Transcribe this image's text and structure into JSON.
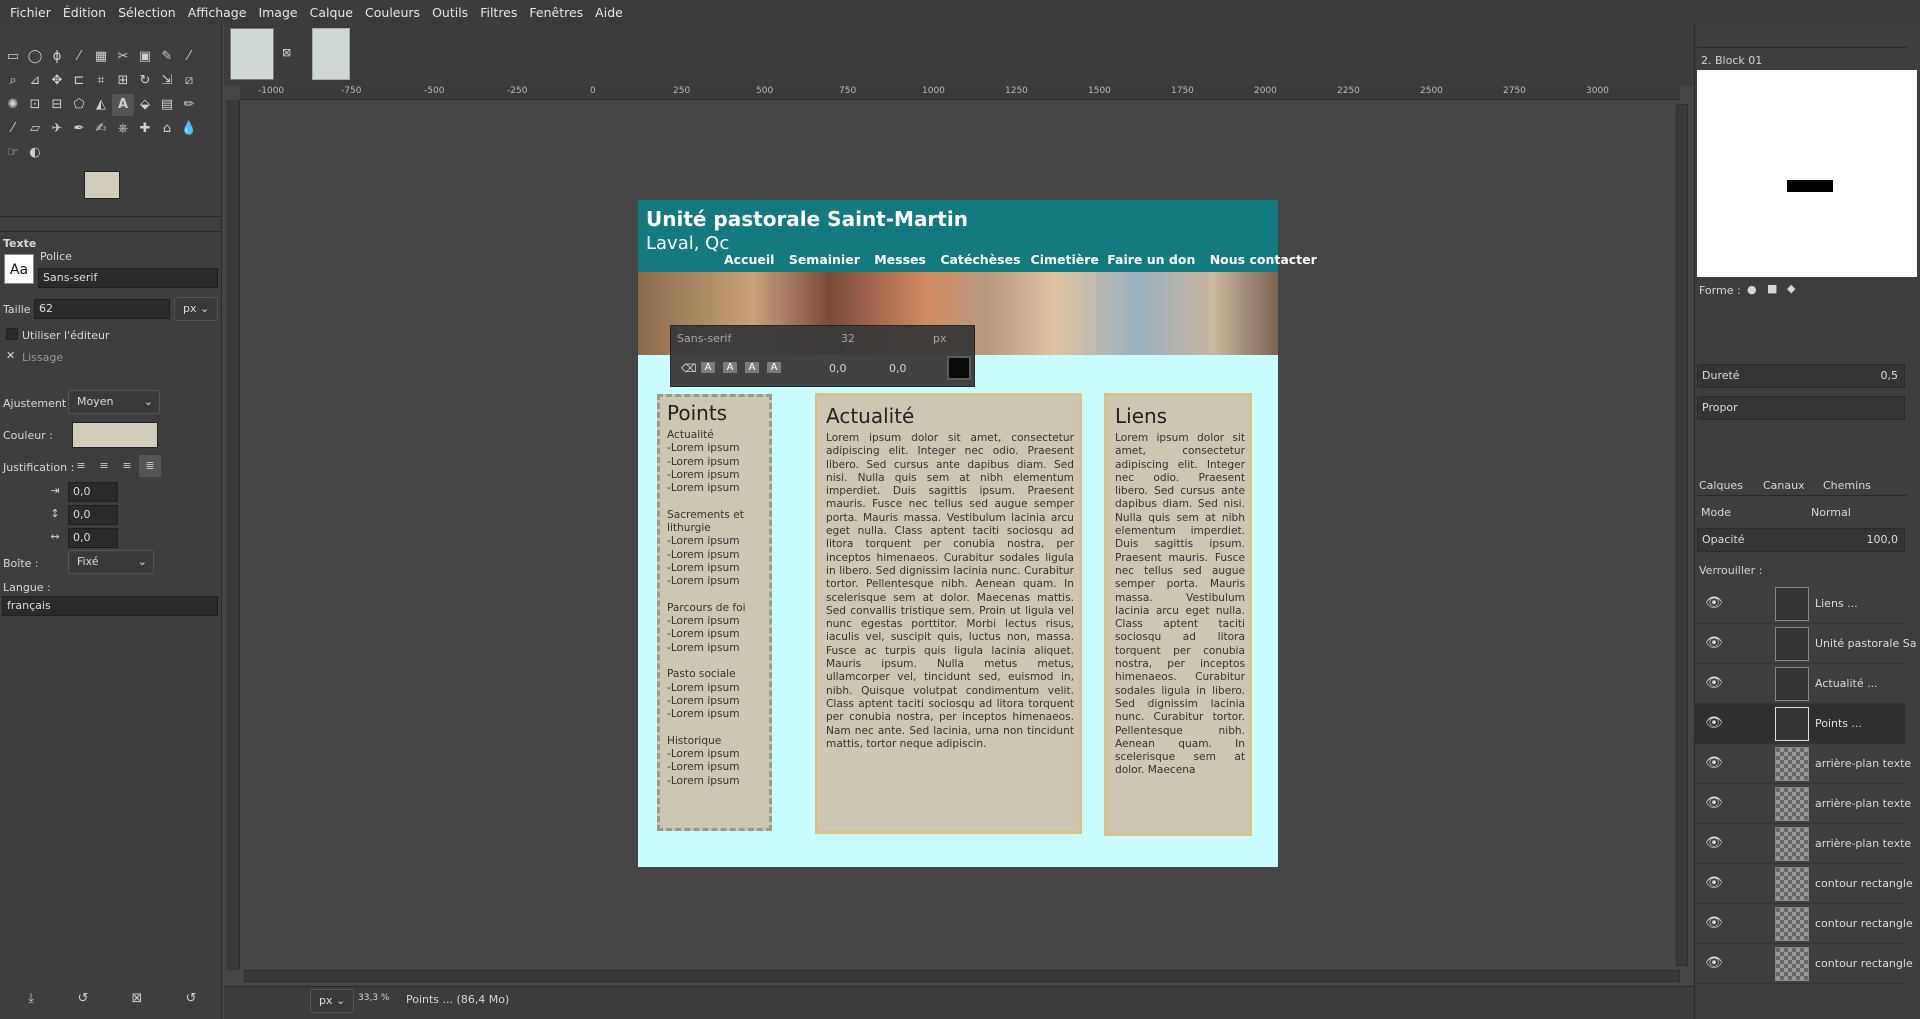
{
  "menu": [
    "Fichier",
    "Édition",
    "Sélection",
    "Affichage",
    "Image",
    "Calque",
    "Couleurs",
    "Outils",
    "Filtres",
    "Fenêtres",
    "Aide"
  ],
  "ruler": [
    "-1000",
    "-750",
    "-500",
    "-250",
    "0",
    "250",
    "500",
    "750",
    "1000",
    "1250",
    "1500",
    "1750",
    "2000",
    "2250",
    "2500",
    "2750",
    "3000"
  ],
  "tool_options": {
    "title": "Texte",
    "font_label": "Police",
    "font_value": "Sans-serif",
    "size_label": "Taille :",
    "size_value": "62",
    "size_unit": "px",
    "use_editor": "Utiliser l'éditeur",
    "antialias": "Lissage",
    "hinting_label": "Ajustement :",
    "hinting_value": "Moyen",
    "color_label": "Couleur :",
    "justify_label": "Justification :",
    "indent": "0,0",
    "line_spacing": "0,0",
    "letter_spacing": "0,0",
    "box_label": "Boîte :",
    "box_value": "Fixé",
    "lang_label": "Langue :",
    "lang_value": "français",
    "text_color": "#d2ccbb"
  },
  "page": {
    "title": "Unité pastorale Saint-Martin",
    "subtitle": "Laval, Qc",
    "nav": [
      "Accueil",
      "Semainier",
      "Messes",
      "Catéchèses",
      "Cimetière",
      "Faire un don",
      "Nous contacter"
    ],
    "header_color": "#157a80",
    "bg_color": "#c8fcfd"
  },
  "text_toolbar": {
    "font": "Sans-serif",
    "size": "32",
    "unit": "px",
    "baseline": "0,0",
    "kerning": "0,0"
  },
  "columns": {
    "points": {
      "title": "Points",
      "body": "Actualité\n-Lorem ipsum\n-Lorem ipsum\n-Lorem ipsum\n-Lorem ipsum\n\nSacrements         et\nlithurgie\n-Lorem ipsum\n-Lorem ipsum\n-Lorem ipsum\n-Lorem ipsum\n\nParcours de foi\n-Lorem ipsum\n-Lorem ipsum\n-Lorem ipsum\n\nPasto sociale\n-Lorem ipsum\n-Lorem ipsum\n-Lorem ipsum\n\nHistorique\n-Lorem ipsum\n-Lorem ipsum\n-Lorem ipsum"
    },
    "actualite": {
      "title": "Actualité",
      "body": "Lorem ipsum dolor sit amet, consectetur adipiscing elit. Integer nec odio. Praesent libero. Sed cursus ante dapibus diam. Sed nisi. Nulla quis sem at nibh elementum imperdiet. Duis sagittis ipsum. Praesent mauris. Fusce nec tellus sed augue semper porta. Mauris massa. Vestibulum lacinia arcu eget nulla. Class aptent taciti sociosqu ad litora torquent per conubia nostra, per inceptos himenaeos. Curabitur sodales ligula in libero. Sed dignissim lacinia nunc. Curabitur tortor. Pellentesque nibh. Aenean quam. In scelerisque sem at dolor. Maecenas mattis. Sed convallis tristique sem. Proin ut ligula vel nunc egestas porttitor. Morbi lectus risus, iaculis vel, suscipit quis, luctus non, massa. Fusce ac turpis quis ligula lacinia aliquet. Mauris ipsum. Nulla metus metus, ullamcorper vel, tincidunt sed, euismod in, nibh. Quisque volutpat condimentum velit. Class aptent taciti sociosqu ad litora torquent per conubia nostra, per inceptos himenaeos. Nam nec ante. Sed lacinia, urna non tincidunt mattis, tortor neque adipiscin."
    },
    "liens": {
      "title": "Liens",
      "body": "Lorem ipsum dolor sit amet, consectetur adipiscing elit. Integer nec odio. Praesent libero. Sed cursus ante dapibus diam. Sed nisi. Nulla quis sem at nibh elementum imperdiet. Duis sagittis ipsum. Praesent mauris. Fusce nec tellus sed augue semper porta. Mauris massa. Vestibulum lacinia arcu eget nulla. Class aptent taciti sociosqu ad litora torquent per conubia nostra, per inceptos himenaeos. Curabitur sodales ligula in libero. Sed dignissim lacinia nunc. Curabitur tortor. Pellentesque nibh. Aenean quam. In scelerisque sem at dolor. Maecena"
    }
  },
  "brush": {
    "name": "2. Block 01",
    "shape_label": "Forme :",
    "hardness_label": "Dureté",
    "hardness_value": "0,5",
    "proportion_label": "Propor"
  },
  "layers": {
    "tabs": [
      "Calques",
      "Canaux",
      "Chemins"
    ],
    "mode_label": "Mode",
    "mode_value": "Normal",
    "opacity_label": "Opacité",
    "opacity_value": "100,0",
    "lock_label": "Verrouiller :",
    "items": [
      "Liens ...",
      "Unité pastorale Sa",
      "Actualité ...",
      "Points ...",
      "arrière-plan texte",
      "arrière-plan texte",
      "arrière-plan texte",
      "contour rectangle",
      "contour rectangle",
      "contour rectangle"
    ]
  },
  "status": {
    "unit": "px",
    "zoom": "33,3 %",
    "info": "Points ... (86,4 Mo)"
  }
}
